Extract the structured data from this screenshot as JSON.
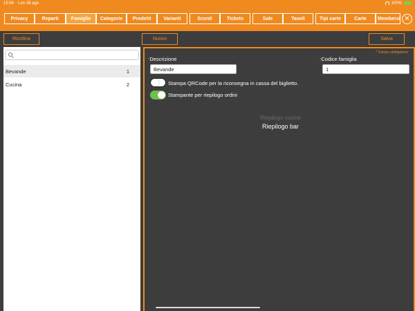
{
  "status": {
    "time": "15:54",
    "date": "Lun 28 ago",
    "battery": "100%"
  },
  "tabs": [
    {
      "label": "Privacy"
    },
    {
      "label": "Reparti"
    },
    {
      "label": "Famiglie",
      "active": true
    },
    {
      "label": "Categorie"
    },
    {
      "label": "Prodotti"
    },
    {
      "label": "Varianti"
    },
    {
      "label": "Sconti"
    },
    {
      "label": "Tickets"
    },
    {
      "label": "Sale"
    },
    {
      "label": "Tavoli"
    },
    {
      "label": "Tipi carte"
    },
    {
      "label": "Carte"
    },
    {
      "label": "Membersi"
    }
  ],
  "close_symbol": "✕",
  "buttons": {
    "reorder": "Riordina",
    "new": "Nuovo",
    "save": "Salva"
  },
  "search": {
    "placeholder": ""
  },
  "families": [
    {
      "name": "Bevande",
      "count": "1"
    },
    {
      "name": "Cucina",
      "count": "2"
    }
  ],
  "form": {
    "required_note": "* Campo obbligatorio",
    "description_label": "Descrizione",
    "description_value": "Bevande",
    "code_label": "Codice famiglia",
    "code_value": "1",
    "qr_label": "Stampa QRCode per la riconsegna in cassa del biglietto.",
    "qr_on": false,
    "printer_label": "Stampante per riepilogo ordini",
    "printer_on": true,
    "printer_options": [
      "Riepilogo cucina",
      "Riepilogo bar"
    ],
    "printer_selected": "Riepilogo bar"
  },
  "colors": {
    "accent": "#f08a1f",
    "background": "#3d3d3d",
    "toggle_on": "#6cc24a"
  }
}
